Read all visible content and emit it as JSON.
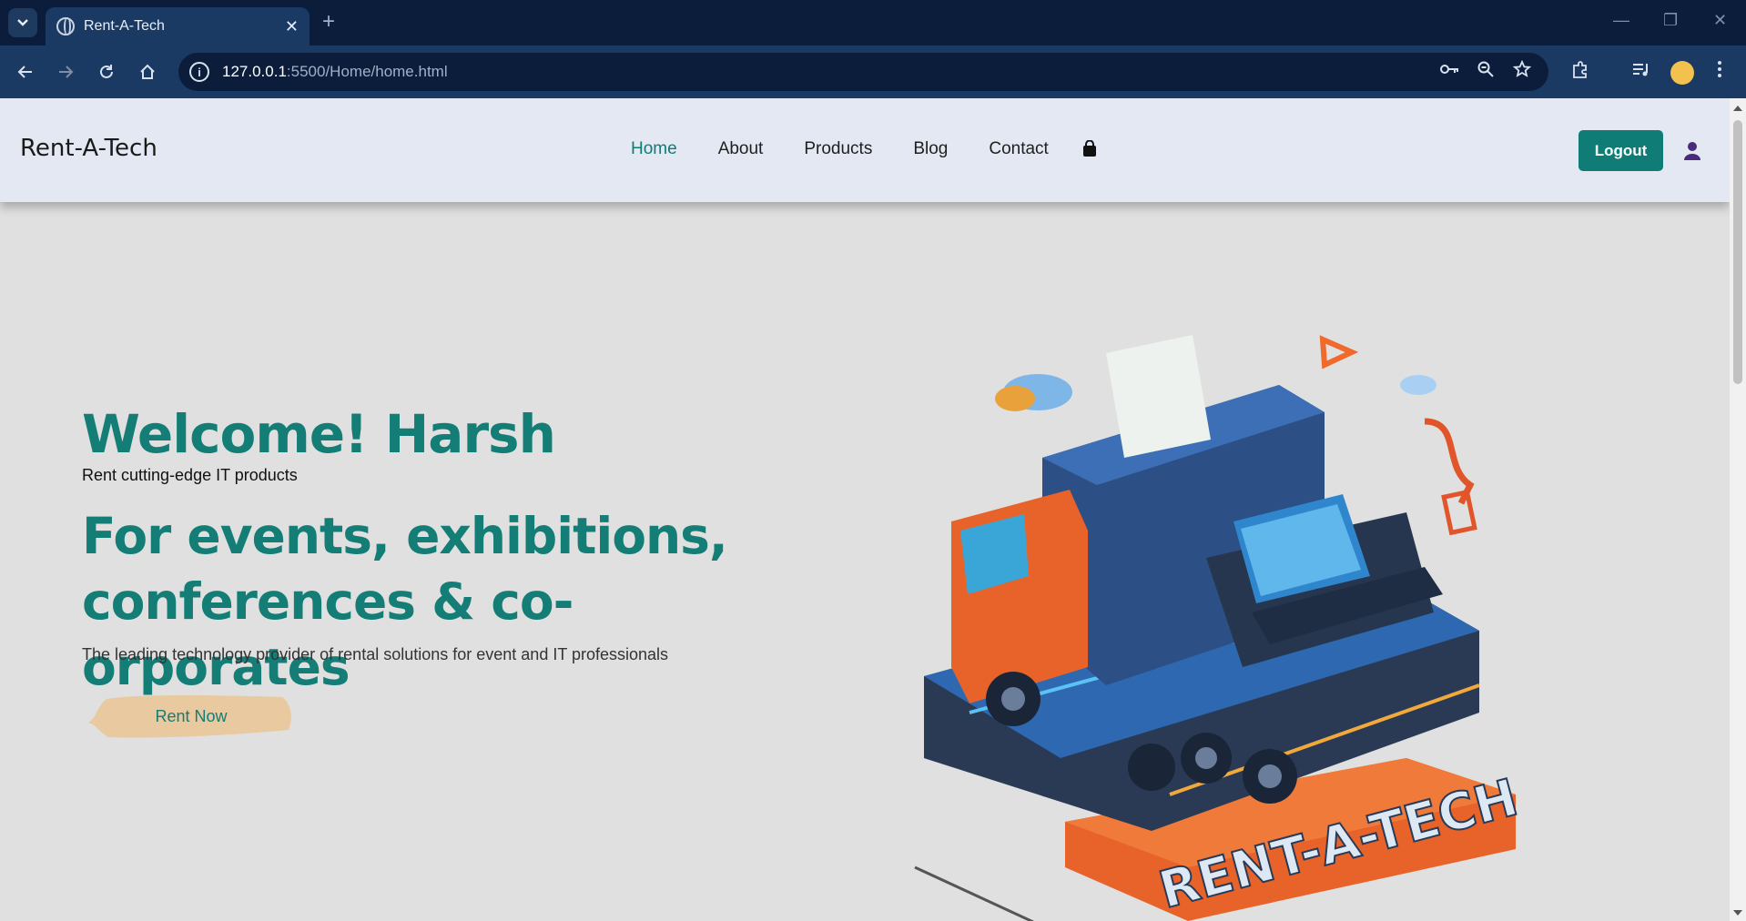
{
  "browser": {
    "tab_title": "Rent-A-Tech",
    "url_host": "127.0.0.1",
    "url_rest": ":5500/Home/home.html"
  },
  "header": {
    "brand": "Rent-A-Tech",
    "nav": [
      "Home",
      "About",
      "Products",
      "Blog",
      "Contact"
    ],
    "active_nav": "Home",
    "logout_label": "Logout"
  },
  "hero": {
    "welcome": "Welcome! Harsh",
    "subtitle": "Rent cutting-edge IT products",
    "headline": "For events, exhibitions, conferences & co-orporates",
    "description": "The leading technology provider of rental solutions for event and IT professionals",
    "cta": "Rent Now",
    "art_text": "RENT-A-TECH"
  },
  "colors": {
    "accent": "#137d76",
    "page_bg": "#e0e0e0",
    "header_bg": "#e3e8f3",
    "cta_bg": "#e8c9a0"
  }
}
